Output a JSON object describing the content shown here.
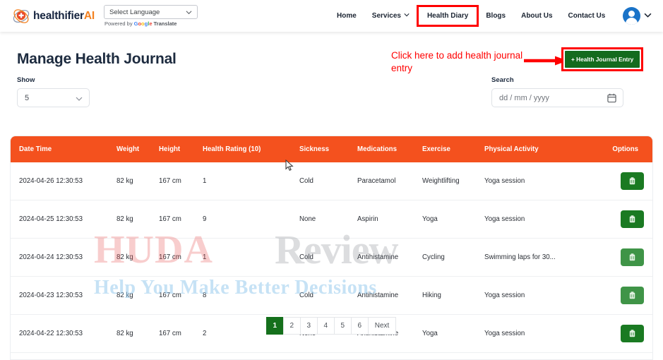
{
  "header": {
    "logo_name": "healthifier",
    "logo_suffix": "AI",
    "language_select_value": "Select Language",
    "powered_by_label": "Powered by",
    "google_letters": [
      "G",
      "o",
      "o",
      "g",
      "l",
      "e"
    ],
    "translate_label": "Translate",
    "nav": [
      {
        "label": "Home",
        "highlighted": false,
        "dropdown": false
      },
      {
        "label": "Services",
        "highlighted": false,
        "dropdown": true
      },
      {
        "label": "Health Diary",
        "highlighted": true,
        "dropdown": false
      },
      {
        "label": "Blogs",
        "highlighted": false,
        "dropdown": false
      },
      {
        "label": "About Us",
        "highlighted": false,
        "dropdown": false
      },
      {
        "label": "Contact Us",
        "highlighted": false,
        "dropdown": false
      }
    ],
    "avatar_icon": "user-avatar-icon"
  },
  "page": {
    "title": "Manage Health Journal",
    "show_label": "Show",
    "show_value": "5",
    "search_label": "Search",
    "search_placeholder": "dd / mm / yyyy",
    "calendar_icon": "calendar-icon"
  },
  "annotation": {
    "text": "Click here to add health journal entry",
    "color": "#ff0000",
    "arrow_icon": "arrow-right-icon"
  },
  "cta": {
    "label": "+ Health Journal Entry",
    "bg_color": "#146b1e",
    "highlight_color": "#ff0000"
  },
  "table": {
    "header_bg": "#f4511e",
    "columns": [
      "Date Time",
      "Weight",
      "Height",
      "Health Rating (10)",
      "Sickness",
      "Medications",
      "Exercise",
      "Physical Activity",
      "Options"
    ],
    "rows": [
      {
        "date_time": "2024-04-26 12:30:53",
        "weight": "82 kg",
        "height": "167 cm",
        "health_rating": "1",
        "sickness": "Cold",
        "medications": "Paracetamol",
        "exercise": "Weightlifting",
        "physical_activity": "Yoga session",
        "delete_icon": "delete-icon"
      },
      {
        "date_time": "2024-04-25 12:30:53",
        "weight": "82 kg",
        "height": "167 cm",
        "health_rating": "9",
        "sickness": "None",
        "medications": "Aspirin",
        "exercise": "Yoga",
        "physical_activity": "Yoga session",
        "delete_icon": "delete-icon"
      },
      {
        "date_time": "2024-04-24 12:30:53",
        "weight": "82 kg",
        "height": "167 cm",
        "health_rating": "1",
        "sickness": "Cold",
        "medications": "Antihistamine",
        "exercise": "Cycling",
        "physical_activity": "Swimming laps for 30...",
        "delete_icon": "delete-icon"
      },
      {
        "date_time": "2024-04-23 12:30:53",
        "weight": "82 kg",
        "height": "167 cm",
        "health_rating": "8",
        "sickness": "Cold",
        "medications": "Antihistamine",
        "exercise": "Hiking",
        "physical_activity": "Yoga session",
        "delete_icon": "delete-icon"
      },
      {
        "date_time": "2024-04-22 12:30:53",
        "weight": "82 kg",
        "height": "167 cm",
        "health_rating": "2",
        "sickness": "None",
        "medications": "Antihistamine",
        "exercise": "Yoga",
        "physical_activity": "Yoga session",
        "delete_icon": "delete-icon"
      }
    ]
  },
  "pagination": {
    "pages": [
      "1",
      "2",
      "3",
      "4",
      "5",
      "6"
    ],
    "active": "1",
    "next_label": "Next",
    "active_color": "#15701c"
  },
  "watermark": {
    "part1": "HUDA",
    "part2": "Review",
    "tagline": "Help You Make Better Decisions"
  }
}
